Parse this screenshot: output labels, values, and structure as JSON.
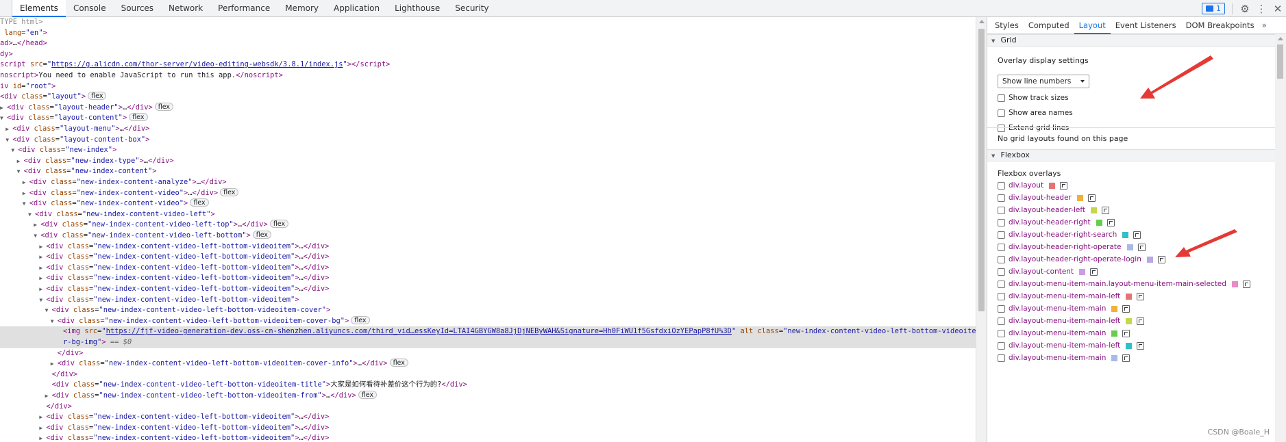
{
  "toolbar": {
    "tabs": [
      "Elements",
      "Console",
      "Sources",
      "Network",
      "Performance",
      "Memory",
      "Application",
      "Lighthouse",
      "Security"
    ],
    "issues_count": "1"
  },
  "dom_rows": [
    {
      "indent": 0,
      "tri": "",
      "html": "<span class='tok-gray'>TYPE html&gt;</span>"
    },
    {
      "indent": 0,
      "tri": "",
      "html": "<span class='tok-attr'> lang</span>=<span class='tok-val'>\"en\"</span><span class='tok-tag'>&gt;</span>"
    },
    {
      "indent": 0,
      "tri": "",
      "html": "<span class='tok-tag'>ad&gt;</span><span class='tok-text'>…</span><span class='tok-tag'>&lt;/head&gt;</span>"
    },
    {
      "indent": 0,
      "tri": "",
      "html": "<span class='tok-tag'>dy&gt;</span>"
    },
    {
      "indent": 0,
      "tri": "",
      "html": "<span class='tok-tag'>script</span> <span class='tok-attr'>src</span>=<span class='tok-val'>\"</span><span class='tok-link'>https://g.alicdn.com/thor-server/video-editing-websdk/3.8.1/index.js</span><span class='tok-val'>\"</span><span class='tok-tag'>&gt;&lt;/script&gt;</span>"
    },
    {
      "indent": 0,
      "tri": "",
      "html": "<span class='tok-tag'>noscript&gt;</span><span class='tok-text'>You need to enable JavaScript to run this app.</span><span class='tok-tag'>&lt;/noscript&gt;</span>"
    },
    {
      "indent": 0,
      "tri": "",
      "html": "<span class='tok-tag'>iv</span> <span class='tok-attr'>id</span>=<span class='tok-val'>\"root\"</span><span class='tok-tag'>&gt;</span>"
    },
    {
      "indent": 0,
      "tri": "",
      "html": "<span class='tok-tag'>&lt;div</span> <span class='tok-attr'>class</span>=<span class='tok-val'>\"layout\"</span><span class='tok-tag'>&gt;</span>",
      "badge": true
    },
    {
      "indent": 0,
      "tri": "▶",
      "html": "<span class='tok-tag'>&lt;div</span> <span class='tok-attr'>class</span>=<span class='tok-val'>\"layout-header\"</span><span class='tok-tag'>&gt;</span><span class='tok-text'>…</span><span class='tok-tag'>&lt;/div&gt;</span>",
      "badge": true
    },
    {
      "indent": 0,
      "tri": "▼",
      "html": "<span class='tok-tag'>&lt;div</span> <span class='tok-attr'>class</span>=<span class='tok-val'>\"layout-content\"</span><span class='tok-tag'>&gt;</span>",
      "badge": true
    },
    {
      "indent": 1,
      "tri": "▶",
      "html": "<span class='tok-tag'>&lt;div</span> <span class='tok-attr'>class</span>=<span class='tok-val'>\"layout-menu\"</span><span class='tok-tag'>&gt;</span><span class='tok-text'>…</span><span class='tok-tag'>&lt;/div&gt;</span>"
    },
    {
      "indent": 1,
      "tri": "▼",
      "html": "<span class='tok-tag'>&lt;div</span> <span class='tok-attr'>class</span>=<span class='tok-val'>\"layout-content-box\"</span><span class='tok-tag'>&gt;</span>"
    },
    {
      "indent": 2,
      "tri": "▼",
      "html": "<span class='tok-tag'>&lt;div</span> <span class='tok-attr'>class</span>=<span class='tok-val'>\"new-index\"</span><span class='tok-tag'>&gt;</span>"
    },
    {
      "indent": 3,
      "tri": "▶",
      "html": "<span class='tok-tag'>&lt;div</span> <span class='tok-attr'>class</span>=<span class='tok-val'>\"new-index-type\"</span><span class='tok-tag'>&gt;</span><span class='tok-text'>…</span><span class='tok-tag'>&lt;/div&gt;</span>"
    },
    {
      "indent": 3,
      "tri": "▼",
      "html": "<span class='tok-tag'>&lt;div</span> <span class='tok-attr'>class</span>=<span class='tok-val'>\"new-index-content\"</span><span class='tok-tag'>&gt;</span>"
    },
    {
      "indent": 4,
      "tri": "▶",
      "html": "<span class='tok-tag'>&lt;div</span> <span class='tok-attr'>class</span>=<span class='tok-val'>\"new-index-content-analyze\"</span><span class='tok-tag'>&gt;</span><span class='tok-text'>…</span><span class='tok-tag'>&lt;/div&gt;</span>"
    },
    {
      "indent": 4,
      "tri": "▶",
      "html": "<span class='tok-tag'>&lt;div</span> <span class='tok-attr'>class</span>=<span class='tok-val'>\"new-index-content-video\"</span><span class='tok-tag'>&gt;</span><span class='tok-text'>…</span><span class='tok-tag'>&lt;/div&gt;</span>",
      "badge": true
    },
    {
      "indent": 4,
      "tri": "▼",
      "html": "<span class='tok-tag'>&lt;div</span> <span class='tok-attr'>class</span>=<span class='tok-val'>\"new-index-content-video\"</span><span class='tok-tag'>&gt;</span>",
      "badge": true
    },
    {
      "indent": 5,
      "tri": "▼",
      "html": "<span class='tok-tag'>&lt;div</span> <span class='tok-attr'>class</span>=<span class='tok-val'>\"new-index-content-video-left\"</span><span class='tok-tag'>&gt;</span>"
    },
    {
      "indent": 6,
      "tri": "▶",
      "html": "<span class='tok-tag'>&lt;div</span> <span class='tok-attr'>class</span>=<span class='tok-val'>\"new-index-content-video-left-top\"</span><span class='tok-tag'>&gt;</span><span class='tok-text'>…</span><span class='tok-tag'>&lt;/div&gt;</span>",
      "badge": true
    },
    {
      "indent": 6,
      "tri": "▼",
      "html": "<span class='tok-tag'>&lt;div</span> <span class='tok-attr'>class</span>=<span class='tok-val'>\"new-index-content-video-left-bottom\"</span><span class='tok-tag'>&gt;</span>",
      "badge": true
    },
    {
      "indent": 7,
      "tri": "▶",
      "html": "<span class='tok-tag'>&lt;div</span> <span class='tok-attr'>class</span>=<span class='tok-val'>\"new-index-content-video-left-bottom-videoitem\"</span><span class='tok-tag'>&gt;</span><span class='tok-text'>…</span><span class='tok-tag'>&lt;/div&gt;</span>"
    },
    {
      "indent": 7,
      "tri": "▶",
      "html": "<span class='tok-tag'>&lt;div</span> <span class='tok-attr'>class</span>=<span class='tok-val'>\"new-index-content-video-left-bottom-videoitem\"</span><span class='tok-tag'>&gt;</span><span class='tok-text'>…</span><span class='tok-tag'>&lt;/div&gt;</span>"
    },
    {
      "indent": 7,
      "tri": "▶",
      "html": "<span class='tok-tag'>&lt;div</span> <span class='tok-attr'>class</span>=<span class='tok-val'>\"new-index-content-video-left-bottom-videoitem\"</span><span class='tok-tag'>&gt;</span><span class='tok-text'>…</span><span class='tok-tag'>&lt;/div&gt;</span>"
    },
    {
      "indent": 7,
      "tri": "▶",
      "html": "<span class='tok-tag'>&lt;div</span> <span class='tok-attr'>class</span>=<span class='tok-val'>\"new-index-content-video-left-bottom-videoitem\"</span><span class='tok-tag'>&gt;</span><span class='tok-text'>…</span><span class='tok-tag'>&lt;/div&gt;</span>"
    },
    {
      "indent": 7,
      "tri": "▶",
      "html": "<span class='tok-tag'>&lt;div</span> <span class='tok-attr'>class</span>=<span class='tok-val'>\"new-index-content-video-left-bottom-videoitem\"</span><span class='tok-tag'>&gt;</span><span class='tok-text'>…</span><span class='tok-tag'>&lt;/div&gt;</span>"
    },
    {
      "indent": 7,
      "tri": "▼",
      "html": "<span class='tok-tag'>&lt;div</span> <span class='tok-attr'>class</span>=<span class='tok-val'>\"new-index-content-video-left-bottom-videoitem\"</span><span class='tok-tag'>&gt;</span>"
    },
    {
      "indent": 8,
      "tri": "▼",
      "html": "<span class='tok-tag'>&lt;div</span> <span class='tok-attr'>class</span>=<span class='tok-val'>\"new-index-content-video-left-bottom-videoitem-cover\"</span><span class='tok-tag'>&gt;</span>"
    },
    {
      "indent": 9,
      "tri": "▼",
      "html": "<span class='tok-tag'>&lt;div</span> <span class='tok-attr'>class</span>=<span class='tok-val'>\"new-index-content-video-left-bottom-videoitem-cover-bg\"</span><span class='tok-tag'>&gt;</span>",
      "badge": true
    },
    {
      "indent": 10,
      "tri": "",
      "sel": true,
      "html": "<span class='tok-tag'>&lt;img</span> <span class='tok-attr'>src</span>=<span class='tok-val'>\"</span><span class='tok-link'>https://fjf-video-generation-dev.oss-cn-shenzhen.aliyuncs.com/third_vid…essKeyId=LTAI4GBYGW8a8JjDjNEByWAH&amp;Signature=Hh0FiWU1f5GsfdxiOzYEPapP8fU%3D</span><span class='tok-val'>\"</span> <span class='tok-attr'>alt</span> <span class='tok-attr'>class</span>=<span class='tok-val'>\"new-index-content-video-left-bottom-videoitem-cove</span>"
    },
    {
      "indent": 10,
      "tri": "",
      "sel": true,
      "html": "<span class='tok-val'>r-bg-img\"</span><span class='tok-tag'>&gt;</span> <span class='tok-dollar'>== $0</span>"
    },
    {
      "indent": 9,
      "tri": "",
      "html": "<span class='tok-tag'>&lt;/div&gt;</span>"
    },
    {
      "indent": 9,
      "tri": "▶",
      "html": "<span class='tok-tag'>&lt;div</span> <span class='tok-attr'>class</span>=<span class='tok-val'>\"new-index-content-video-left-bottom-videoitem-cover-info\"</span><span class='tok-tag'>&gt;</span><span class='tok-text'>…</span><span class='tok-tag'>&lt;/div&gt;</span>",
      "badge": true
    },
    {
      "indent": 8,
      "tri": "",
      "html": "<span class='tok-tag'>&lt;/div&gt;</span>"
    },
    {
      "indent": 8,
      "tri": "",
      "html": "<span class='tok-tag'>&lt;div</span> <span class='tok-attr'>class</span>=<span class='tok-val'>\"new-index-content-video-left-bottom-videoitem-title\"</span><span class='tok-tag'>&gt;</span><span class='tok-text'>大家是如何看待补差价这个行为的?</span><span class='tok-tag'>&lt;/div&gt;</span>"
    },
    {
      "indent": 8,
      "tri": "▶",
      "html": "<span class='tok-tag'>&lt;div</span> <span class='tok-attr'>class</span>=<span class='tok-val'>\"new-index-content-video-left-bottom-videoitem-from\"</span><span class='tok-tag'>&gt;</span><span class='tok-text'>…</span><span class='tok-tag'>&lt;/div&gt;</span>",
      "badge": true
    },
    {
      "indent": 7,
      "tri": "",
      "html": "<span class='tok-tag'>&lt;/div&gt;</span>"
    },
    {
      "indent": 7,
      "tri": "▶",
      "html": "<span class='tok-tag'>&lt;div</span> <span class='tok-attr'>class</span>=<span class='tok-val'>\"new-index-content-video-left-bottom-videoitem\"</span><span class='tok-tag'>&gt;</span><span class='tok-text'>…</span><span class='tok-tag'>&lt;/div&gt;</span>"
    },
    {
      "indent": 7,
      "tri": "▶",
      "html": "<span class='tok-tag'>&lt;div</span> <span class='tok-attr'>class</span>=<span class='tok-val'>\"new-index-content-video-left-bottom-videoitem\"</span><span class='tok-tag'>&gt;</span><span class='tok-text'>…</span><span class='tok-tag'>&lt;/div&gt;</span>"
    },
    {
      "indent": 7,
      "tri": "▶",
      "html": "<span class='tok-tag'>&lt;div</span> <span class='tok-attr'>class</span>=<span class='tok-val'>\"new-index-content-video-left-bottom-videoitem\"</span><span class='tok-tag'>&gt;</span><span class='tok-text'>…</span><span class='tok-tag'>&lt;/div&gt;</span>"
    }
  ],
  "flex_badge": "flex",
  "side": {
    "tabs": [
      "Styles",
      "Computed",
      "Layout",
      "Event Listeners",
      "DOM Breakpoints"
    ],
    "more": "»",
    "grid_header": "Grid",
    "overlay_title": "Overlay display settings",
    "select_value": "Show line numbers",
    "grid_options": [
      "Show track sizes",
      "Show area names",
      "Extend grid lines"
    ],
    "no_grid": "No grid layouts found on this page",
    "flexbox_header": "Flexbox",
    "flex_title": "Flexbox overlays",
    "flex_items": [
      {
        "label": "div.layout",
        "color": "#e57373"
      },
      {
        "label": "div.layout-header",
        "color": "#f0b13c"
      },
      {
        "label": "div.layout-header-left",
        "color": "#c6d84a"
      },
      {
        "label": "div.layout-header-right",
        "color": "#66cc4d"
      },
      {
        "label": "div.layout-header-right-search",
        "color": "#30c0c8"
      },
      {
        "label": "div.layout-header-right-operate",
        "color": "#a9b9ea"
      },
      {
        "label": "div.layout-header-right-operate-login",
        "color": "#b7a8e6"
      },
      {
        "label": "div.layout-content",
        "color": "#cf9be8"
      },
      {
        "label": "div.layout-menu-item-main.layout-menu-item-main-selected",
        "color": "#e88bc6"
      },
      {
        "label": "div.layout-menu-item-main-left",
        "color": "#e57373"
      },
      {
        "label": "div.layout-menu-item-main",
        "color": "#f0b13c"
      },
      {
        "label": "div.layout-menu-item-main-left",
        "color": "#c6d84a"
      },
      {
        "label": "div.layout-menu-item-main",
        "color": "#66cc4d"
      },
      {
        "label": "div.layout-menu-item-main-left",
        "color": "#30c0c8"
      },
      {
        "label": "div.layout-menu-item-main",
        "color": "#a9b9ea"
      }
    ]
  },
  "watermark": "CSDN @Boale_H",
  "colors": {
    "accent": "#1a73e8",
    "arrow": "#e53935"
  }
}
